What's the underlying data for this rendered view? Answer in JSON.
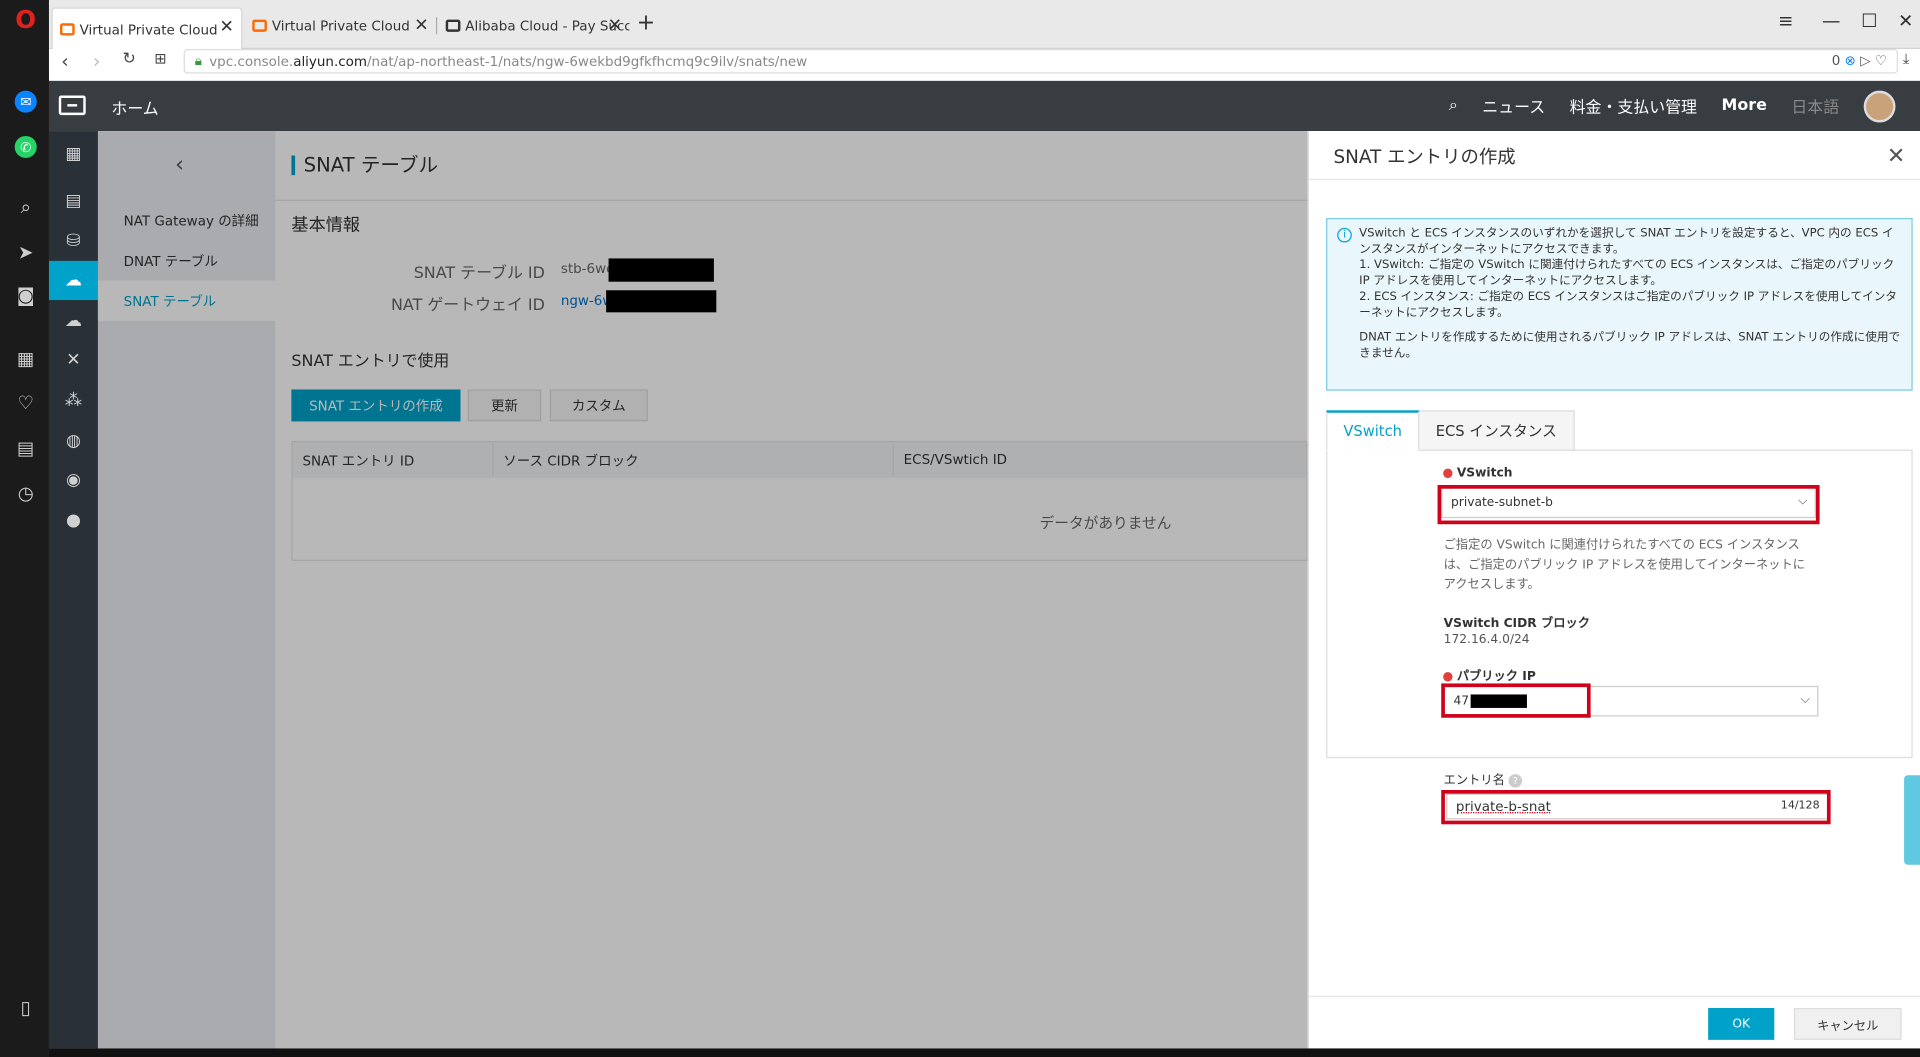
{
  "browser": {
    "tabs": [
      {
        "title": "Virtual Private Cloud"
      },
      {
        "title": "Virtual Private Cloud"
      },
      {
        "title": "Alibaba Cloud - Pay Succe"
      }
    ],
    "url_prefix": "vpc.console.",
    "url_domain": "aliyun.com",
    "url_path": "/nat/ap-northeast-1/nats/ngw-6wekbd9gfkfhcmq9c9ilv/snats/new",
    "url_badge": "0"
  },
  "header": {
    "home": "ホーム",
    "news": "ニュース",
    "billing": "料金・支払い管理",
    "more": "More",
    "language": "日本語"
  },
  "sidebar": {
    "items": [
      {
        "label": "NAT Gateway の詳細"
      },
      {
        "label": "DNAT テーブル"
      },
      {
        "label": "SNAT テーブル"
      }
    ]
  },
  "main": {
    "title": "SNAT テーブル",
    "basic_info": "基本情報",
    "snat_table_id_label": "SNAT テーブル ID",
    "snat_table_id_value": "stb-6we3",
    "nat_gateway_id_label": "NAT ゲートウェイ ID",
    "nat_gateway_id_value": "ngw-6we",
    "section_title": "SNAT エントリで使用",
    "buttons": {
      "create": "SNAT エントリの作成",
      "refresh": "更新",
      "custom": "カスタム"
    },
    "table": {
      "columns": [
        "SNAT エントリ ID",
        "ソース CIDR ブロック",
        "ECS/VSwtich ID"
      ],
      "empty": "データがありません"
    }
  },
  "dialog": {
    "title": "SNAT エントリの作成",
    "info": {
      "line1": "VSwitch と ECS インスタンスのいずれかを選択して SNAT エントリを設定すると、VPC 内の ECS インスタンスがインターネットにアクセスできます。",
      "line2": "1. VSwitch: ご指定の VSwitch に関連付けられたすべての ECS インスタンスは、ご指定のパブリック IP アドレスを使用してインターネットにアクセスします。",
      "line3": "2. ECS インスタンス: ご指定の ECS インスタンスはご指定のパブリック IP アドレスを使用してインターネットにアクセスします。",
      "note": "DNAT エントリを作成するために使用されるパブリック IP アドレスは、SNAT エントリの作成に使用できません。"
    },
    "tabs": {
      "vswitch": "VSwitch",
      "ecs": "ECS インスタンス"
    },
    "vswitch_label": "VSwitch",
    "vswitch_value": "private-subnet-b",
    "vswitch_help": "ご指定の VSwitch に関連付けられたすべての ECS インスタンスは、ご指定のパブリック IP アドレスを使用してインターネットにアクセスします。",
    "cidr_label": "VSwitch CIDR ブロック",
    "cidr_value": "172.16.4.0/24",
    "public_ip_label": "パブリック IP",
    "public_ip_value": "47",
    "entry_name_label": "エントリ名",
    "entry_name_value": "private-b-snat",
    "entry_name_count": "14/128",
    "ok": "OK",
    "cancel": "キャンセル"
  },
  "colors": {
    "accent": "#00a2ca",
    "highlight": "#d0021b",
    "header": "#373d41"
  }
}
